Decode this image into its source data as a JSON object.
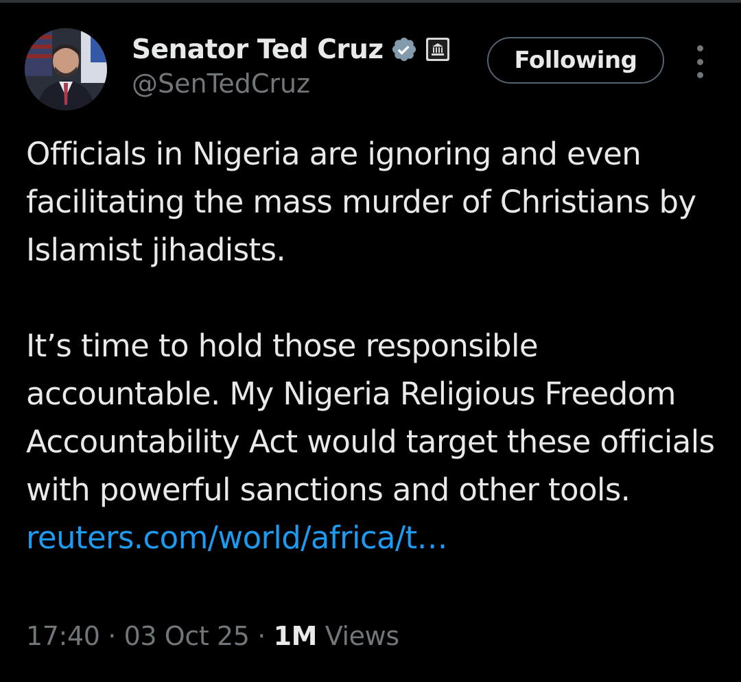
{
  "author": {
    "display_name": "Senator Ted Cruz",
    "handle": "@SenTedCruz"
  },
  "follow_button": {
    "label": "Following"
  },
  "tweet": {
    "paragraph_1": "Officials in Nigeria are ignoring and even facilitating the mass murder of Christians by Islamist jihadists.",
    "paragraph_2_text": "It’s time to hold those responsible accountable. My Nigeria Religious Freedom Accountability Act would target these officials with powerful sanctions and other tools.",
    "link_text": "reuters.com/world/africa/t…"
  },
  "meta": {
    "time": "17:40",
    "date": "03 Oct 25",
    "separator": "·",
    "views_count": "1M",
    "views_label": "Views"
  },
  "icons": {
    "verified": "verified-badge-icon",
    "government": "government-building-icon",
    "more": "more-options-icon"
  },
  "colors": {
    "background": "#000000",
    "text_primary": "#e7e9ea",
    "text_secondary": "#71767b",
    "link": "#1d9bf0",
    "verified_badge": "#829aab",
    "button_border": "#536471"
  }
}
